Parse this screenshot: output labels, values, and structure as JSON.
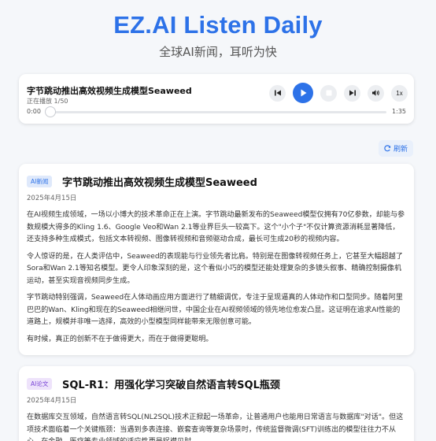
{
  "header": {
    "title": "EZ.AI Listen Daily",
    "subtitle": "全球AI新闻，耳听为快"
  },
  "player": {
    "title": "字节跳动推出高效视频生成模型Seaweed",
    "status": "正在播放 1/50",
    "current_time": "0:00",
    "duration": "1:35",
    "progress": 0,
    "speed": "1x"
  },
  "toolbar": {
    "refresh_label": "刷新"
  },
  "articles": [
    {
      "tag": "AI新闻",
      "title": "字节跳动推出高效视频生成模型Seaweed",
      "date": "2025年4月15日",
      "paragraphs": [
        "在AI视频生成领域，一场以小博大的技术革命正在上演。字节跳动最新发布的Seaweed模型仅拥有70亿参数，却能与参数规模大得多的Kling 1.6、Google Veo和Wan 2.1等业界巨头一较高下。这个\"小个子\"不仅计算资源消耗显著降低，还支持多种生成模式，包括文本转视频、图像转视频和音频驱动合成，最长可生成20秒的视频内容。",
        "令人惊讶的是，在人类评估中，Seaweed的表现能与行业领先者比肩。特别是在图像转视频任务上，它甚至大幅超越了Sora和Wan 2.1等知名模型。更令人印象深刻的是，这个看似小巧的模型还能处理复杂的多镜头叙事、精确控制摄像机运动，甚至实现音视频同步生成。",
        "字节跳动特别强调，Seaweed在人体动画应用方面进行了精细调优，专注于呈现逼真的人体动作和口型同步。随着阿里巴巴的Wan、Kling和现在的Seaweed相继问世，中国企业在AI视频领域的领先地位愈发凸显。这证明在追求AI性能的道路上，规模并非唯一选择，高效的小型模型同样能带来无限创意可能。",
        "有时候，真正的创新不在于做得更大，而在于做得更聪明。"
      ]
    },
    {
      "tag": "AI论文",
      "title": "SQL-R1：用强化学习突破自然语言转SQL瓶颈",
      "date": "2025年4月15日",
      "paragraphs": [
        "在数据库交互领域，自然语言转SQL(NL2SQL)技术正掀起一场革命，让普通用户也能用日常语言与数据库\"对话\"。但这项技术面临着一个关键瓶颈：当遇到多表连接、嵌套查询等复杂场景时，传统监督微调(SFT)训练出的模型往往力不从心，在金融、医疗等专业领域的适应性更是捉襟见肘。"
      ]
    }
  ],
  "colors": {
    "accent": "#2d72e8",
    "paper_badge": "#7a45d6"
  },
  "icons": [
    "skip-back-icon",
    "play-icon",
    "stop-icon",
    "skip-forward-icon",
    "volume-icon",
    "refresh-icon"
  ]
}
